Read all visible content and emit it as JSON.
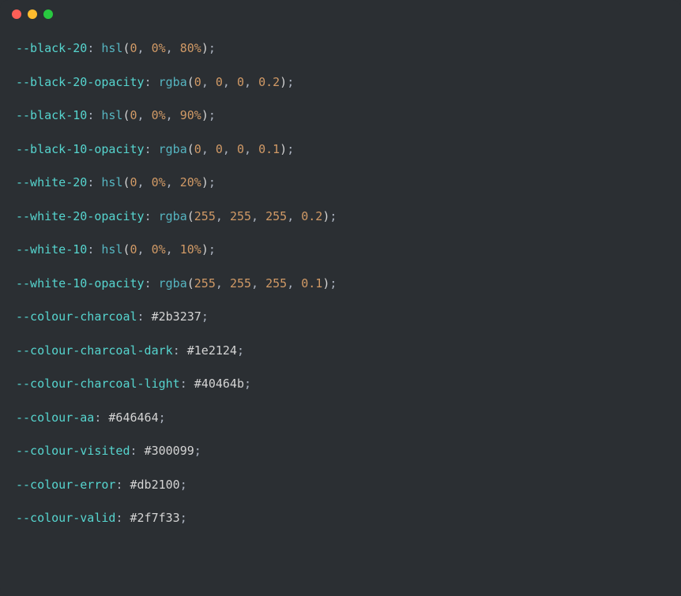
{
  "titlebar": {
    "close": "close",
    "minimize": "minimize",
    "zoom": "zoom"
  },
  "lines": [
    {
      "prop": "--black-20",
      "func": "hsl",
      "args": "0, 0%, 80%"
    },
    {
      "prop": "--black-20-opacity",
      "func": "rgba",
      "args": "0, 0, 0, 0.2"
    },
    {
      "prop": "--black-10",
      "func": "hsl",
      "args": "0, 0%, 90%"
    },
    {
      "prop": "--black-10-opacity",
      "func": "rgba",
      "args": "0, 0, 0, 0.1"
    },
    {
      "prop": "--white-20",
      "func": "hsl",
      "args": "0, 0%, 20%"
    },
    {
      "prop": "--white-20-opacity",
      "func": "rgba",
      "args": "255, 255, 255, 0.2"
    },
    {
      "prop": "--white-10",
      "func": "hsl",
      "args": "0, 0%, 10%"
    },
    {
      "prop": "--white-10-opacity",
      "func": "rgba",
      "args": "255, 255, 255, 0.1"
    },
    {
      "prop": "--colour-charcoal",
      "hex": "#2b3237"
    },
    {
      "prop": "--colour-charcoal-dark",
      "hex": "#1e2124"
    },
    {
      "prop": "--colour-charcoal-light",
      "hex": "#40464b"
    },
    {
      "prop": "--colour-aa",
      "hex": "#646464"
    },
    {
      "prop": "--colour-visited",
      "hex": "#300099"
    },
    {
      "prop": "--colour-error",
      "hex": "#db2100"
    },
    {
      "prop": "--colour-valid",
      "hex": "#2f7f33"
    }
  ]
}
